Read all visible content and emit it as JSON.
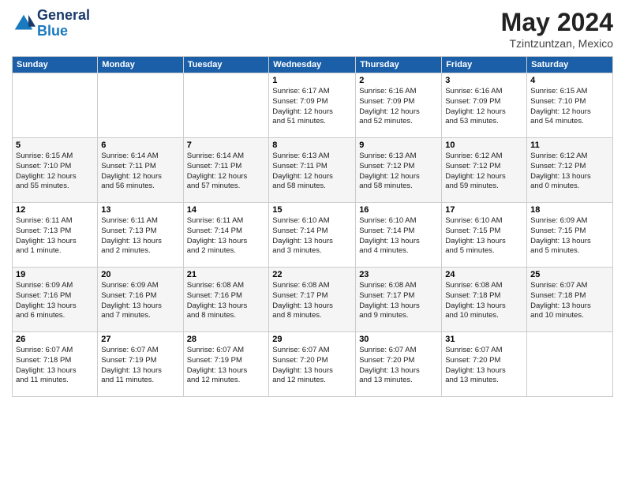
{
  "header": {
    "logo_line1": "General",
    "logo_line2": "Blue",
    "month": "May 2024",
    "location": "Tzintzuntzan, Mexico"
  },
  "weekdays": [
    "Sunday",
    "Monday",
    "Tuesday",
    "Wednesday",
    "Thursday",
    "Friday",
    "Saturday"
  ],
  "weeks": [
    [
      {
        "day": "",
        "text": ""
      },
      {
        "day": "",
        "text": ""
      },
      {
        "day": "",
        "text": ""
      },
      {
        "day": "1",
        "text": "Sunrise: 6:17 AM\nSunset: 7:09 PM\nDaylight: 12 hours\nand 51 minutes."
      },
      {
        "day": "2",
        "text": "Sunrise: 6:16 AM\nSunset: 7:09 PM\nDaylight: 12 hours\nand 52 minutes."
      },
      {
        "day": "3",
        "text": "Sunrise: 6:16 AM\nSunset: 7:09 PM\nDaylight: 12 hours\nand 53 minutes."
      },
      {
        "day": "4",
        "text": "Sunrise: 6:15 AM\nSunset: 7:10 PM\nDaylight: 12 hours\nand 54 minutes."
      }
    ],
    [
      {
        "day": "5",
        "text": "Sunrise: 6:15 AM\nSunset: 7:10 PM\nDaylight: 12 hours\nand 55 minutes."
      },
      {
        "day": "6",
        "text": "Sunrise: 6:14 AM\nSunset: 7:11 PM\nDaylight: 12 hours\nand 56 minutes."
      },
      {
        "day": "7",
        "text": "Sunrise: 6:14 AM\nSunset: 7:11 PM\nDaylight: 12 hours\nand 57 minutes."
      },
      {
        "day": "8",
        "text": "Sunrise: 6:13 AM\nSunset: 7:11 PM\nDaylight: 12 hours\nand 58 minutes."
      },
      {
        "day": "9",
        "text": "Sunrise: 6:13 AM\nSunset: 7:12 PM\nDaylight: 12 hours\nand 58 minutes."
      },
      {
        "day": "10",
        "text": "Sunrise: 6:12 AM\nSunset: 7:12 PM\nDaylight: 12 hours\nand 59 minutes."
      },
      {
        "day": "11",
        "text": "Sunrise: 6:12 AM\nSunset: 7:12 PM\nDaylight: 13 hours\nand 0 minutes."
      }
    ],
    [
      {
        "day": "12",
        "text": "Sunrise: 6:11 AM\nSunset: 7:13 PM\nDaylight: 13 hours\nand 1 minute."
      },
      {
        "day": "13",
        "text": "Sunrise: 6:11 AM\nSunset: 7:13 PM\nDaylight: 13 hours\nand 2 minutes."
      },
      {
        "day": "14",
        "text": "Sunrise: 6:11 AM\nSunset: 7:14 PM\nDaylight: 13 hours\nand 2 minutes."
      },
      {
        "day": "15",
        "text": "Sunrise: 6:10 AM\nSunset: 7:14 PM\nDaylight: 13 hours\nand 3 minutes."
      },
      {
        "day": "16",
        "text": "Sunrise: 6:10 AM\nSunset: 7:14 PM\nDaylight: 13 hours\nand 4 minutes."
      },
      {
        "day": "17",
        "text": "Sunrise: 6:10 AM\nSunset: 7:15 PM\nDaylight: 13 hours\nand 5 minutes."
      },
      {
        "day": "18",
        "text": "Sunrise: 6:09 AM\nSunset: 7:15 PM\nDaylight: 13 hours\nand 5 minutes."
      }
    ],
    [
      {
        "day": "19",
        "text": "Sunrise: 6:09 AM\nSunset: 7:16 PM\nDaylight: 13 hours\nand 6 minutes."
      },
      {
        "day": "20",
        "text": "Sunrise: 6:09 AM\nSunset: 7:16 PM\nDaylight: 13 hours\nand 7 minutes."
      },
      {
        "day": "21",
        "text": "Sunrise: 6:08 AM\nSunset: 7:16 PM\nDaylight: 13 hours\nand 8 minutes."
      },
      {
        "day": "22",
        "text": "Sunrise: 6:08 AM\nSunset: 7:17 PM\nDaylight: 13 hours\nand 8 minutes."
      },
      {
        "day": "23",
        "text": "Sunrise: 6:08 AM\nSunset: 7:17 PM\nDaylight: 13 hours\nand 9 minutes."
      },
      {
        "day": "24",
        "text": "Sunrise: 6:08 AM\nSunset: 7:18 PM\nDaylight: 13 hours\nand 10 minutes."
      },
      {
        "day": "25",
        "text": "Sunrise: 6:07 AM\nSunset: 7:18 PM\nDaylight: 13 hours\nand 10 minutes."
      }
    ],
    [
      {
        "day": "26",
        "text": "Sunrise: 6:07 AM\nSunset: 7:18 PM\nDaylight: 13 hours\nand 11 minutes."
      },
      {
        "day": "27",
        "text": "Sunrise: 6:07 AM\nSunset: 7:19 PM\nDaylight: 13 hours\nand 11 minutes."
      },
      {
        "day": "28",
        "text": "Sunrise: 6:07 AM\nSunset: 7:19 PM\nDaylight: 13 hours\nand 12 minutes."
      },
      {
        "day": "29",
        "text": "Sunrise: 6:07 AM\nSunset: 7:20 PM\nDaylight: 13 hours\nand 12 minutes."
      },
      {
        "day": "30",
        "text": "Sunrise: 6:07 AM\nSunset: 7:20 PM\nDaylight: 13 hours\nand 13 minutes."
      },
      {
        "day": "31",
        "text": "Sunrise: 6:07 AM\nSunset: 7:20 PM\nDaylight: 13 hours\nand 13 minutes."
      },
      {
        "day": "",
        "text": ""
      }
    ]
  ]
}
